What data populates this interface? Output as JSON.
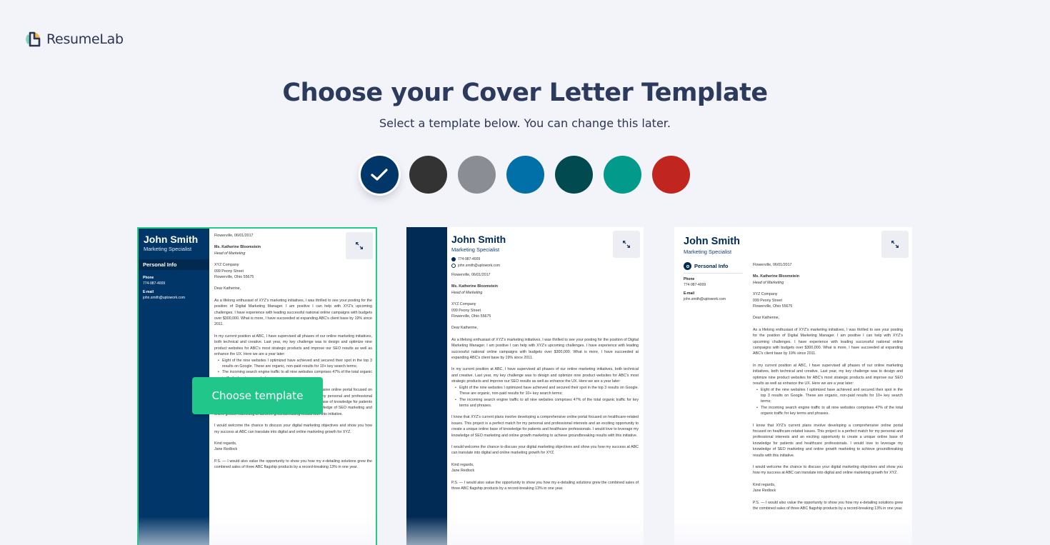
{
  "brand": {
    "name": "ResumeLab"
  },
  "header": {
    "title": "Choose your Cover Letter Template",
    "subtitle": "Select a template below. You can change this later."
  },
  "colors": {
    "selected_index": 0,
    "swatches": [
      {
        "name": "navy",
        "hex": "#013668"
      },
      {
        "name": "charcoal",
        "hex": "#333333"
      },
      {
        "name": "gray",
        "hex": "#8a8e94"
      },
      {
        "name": "blue",
        "hex": "#0170a8"
      },
      {
        "name": "dark-teal",
        "hex": "#014a4f"
      },
      {
        "name": "teal",
        "hex": "#029a8a"
      },
      {
        "name": "red",
        "hex": "#c0261f"
      }
    ]
  },
  "choose_button_label": "Choose template",
  "letter": {
    "name": "John Smith",
    "role": "Marketing Specialist",
    "personal_info_title": "Personal Info",
    "phone_label": "Phone",
    "phone": "774-987-4009",
    "email_label": "E-mail",
    "email": "john.smith@uptowork.com",
    "date": "Flowerville, 06/01/2017",
    "recipient_name": "Ms. Katherine Bloomstein",
    "recipient_title": "Head of Marketing",
    "company": "XYZ Company",
    "street": "099 Peony Street",
    "city": "Flowerville, Ohio 55675",
    "greeting": "Dear Katherine,",
    "p1": "As a lifelong enthusiast of XYZ's marketing initiatives, I was thrilled to see your posting for the position of Digital Marketing Manager. I am positive I can help with XYZ's upcoming challenges. I have experience with leading successful national online campaigns with budgets over $300,000. What is more, I have succeeded at expanding ABC's client base by 19% since 2011.",
    "p2": "In my current position at ABC, I have supervised all phases of our online marketing initiatives, both technical and creative. Last year, my key challenge was to design and optimize nine product websites for ABC's most strategic products and improve our SEO results as well as enhance the UX. Here we are a year later:",
    "bullets": [
      "Eight of the nine websites I optimized have achieved and secured their spot in the top 3 results on Google. These are organic, non-paid results for 10+ key search terms;",
      "The incoming search engine traffic to all nine websites comprises 47% of the total organic traffic for key terms and phrases."
    ],
    "p3": "I know that XYZ's current plans involve developing a comprehensive online portal focused on healthcare-related issues. This project is a perfect match for my personal and professional interests and an exciting opportunity to create a unique online base of knowledge for patients and healthcare professionals. I would love to leverage my knowledge of SEO marketing and online growth marketing to achieve groundbreaking results with this initiative.",
    "p4": "I would welcome the chance to discuss your digital marketing objectives and show you how my success at ABC can translate into digital and online marketing growth for XYZ.",
    "closing": "Kind regards,",
    "signature": "Jane Redlock",
    "ps": "P.S. — I would also value the opportunity to show you how my e-detailing solutions grew the combined sales of three ABC flagship products by a record-breaking 13% in one year."
  }
}
